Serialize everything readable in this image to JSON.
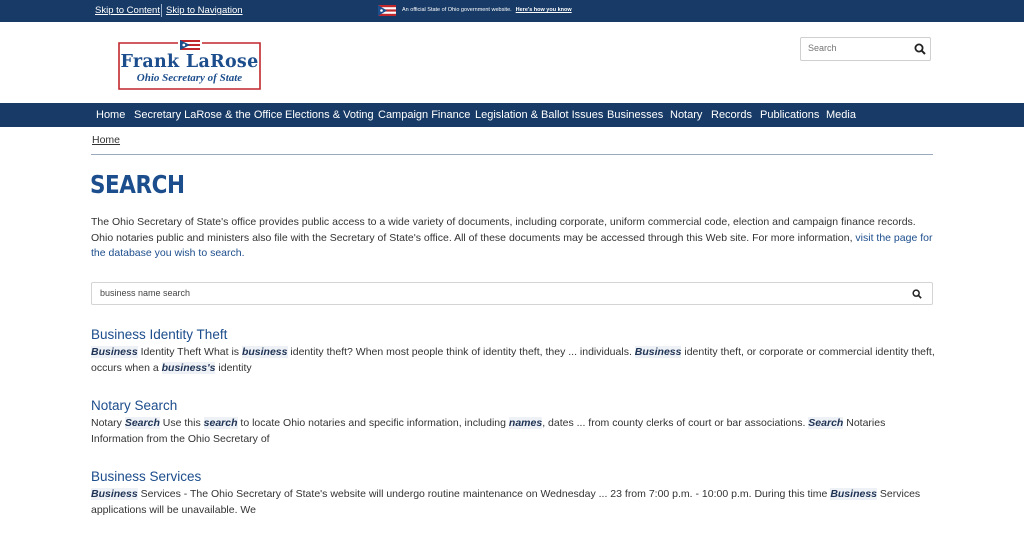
{
  "topbar": {
    "skip_content": "Skip to Content",
    "skip_navigation": "Skip to Navigation",
    "official_text": "An official State of Ohio government website.",
    "official_link": "Here's how you know"
  },
  "logo": {
    "name": "Frank LaRose",
    "subtitle": "Ohio Secretary of State"
  },
  "header_search": {
    "placeholder": "Search"
  },
  "nav": [
    "Home",
    "Secretary LaRose & the Office",
    "Elections & Voting",
    "Campaign Finance",
    "Legislation & Ballot Issues",
    "Businesses",
    "Notary",
    "Records",
    "Publications",
    "Media"
  ],
  "breadcrumb": "Home",
  "page_title": "SEARCH",
  "intro": {
    "text": "The Ohio Secretary of State's office provides public access to a wide variety of documents, including corporate, uniform commercial code, election and campaign finance records. Ohio notaries public and ministers also file with the Secretary of State's office. All of these documents may be accessed through this Web site. For more information, ",
    "link": "visit the page for the database you wish to search."
  },
  "main_search": {
    "value": "business name search"
  },
  "results": [
    {
      "title": "Business Identity Theft",
      "snippet": [
        {
          "t": "Business",
          "h": true
        },
        {
          "t": " Identity Theft What is ",
          "h": false
        },
        {
          "t": "business",
          "h": true
        },
        {
          "t": " identity theft? When most people think of identity theft, they ... individuals. ",
          "h": false
        },
        {
          "t": "Business",
          "h": true
        },
        {
          "t": " identity theft, or corporate or commercial identity theft, occurs when a ",
          "h": false
        },
        {
          "t": "business's",
          "h": true
        },
        {
          "t": " identity",
          "h": false
        }
      ]
    },
    {
      "title": "Notary Search",
      "snippet": [
        {
          "t": "Notary ",
          "h": false
        },
        {
          "t": "Search",
          "h": true
        },
        {
          "t": " Use this ",
          "h": false
        },
        {
          "t": "search",
          "h": true
        },
        {
          "t": " to locate Ohio notaries and specific information, including ",
          "h": false
        },
        {
          "t": "names",
          "h": true
        },
        {
          "t": ", dates ... from county clerks of court or bar associations. ",
          "h": false
        },
        {
          "t": "Search",
          "h": true
        },
        {
          "t": " Notaries Information from the Ohio Secretary of",
          "h": false
        }
      ]
    },
    {
      "title": "Business Services",
      "snippet": [
        {
          "t": "Business",
          "h": true
        },
        {
          "t": " Services - The Ohio Secretary of State's website will undergo routine maintenance on Wednesday ... 23 from 7:00 p.m. - 10:00 p.m. During this time ",
          "h": false
        },
        {
          "t": "Business",
          "h": true
        },
        {
          "t": " Services applications will be unavailable. We",
          "h": false
        }
      ]
    }
  ],
  "colors": {
    "navy": "#173a66",
    "link_blue": "#1c4d8c",
    "logo_red": "#c0272d"
  }
}
